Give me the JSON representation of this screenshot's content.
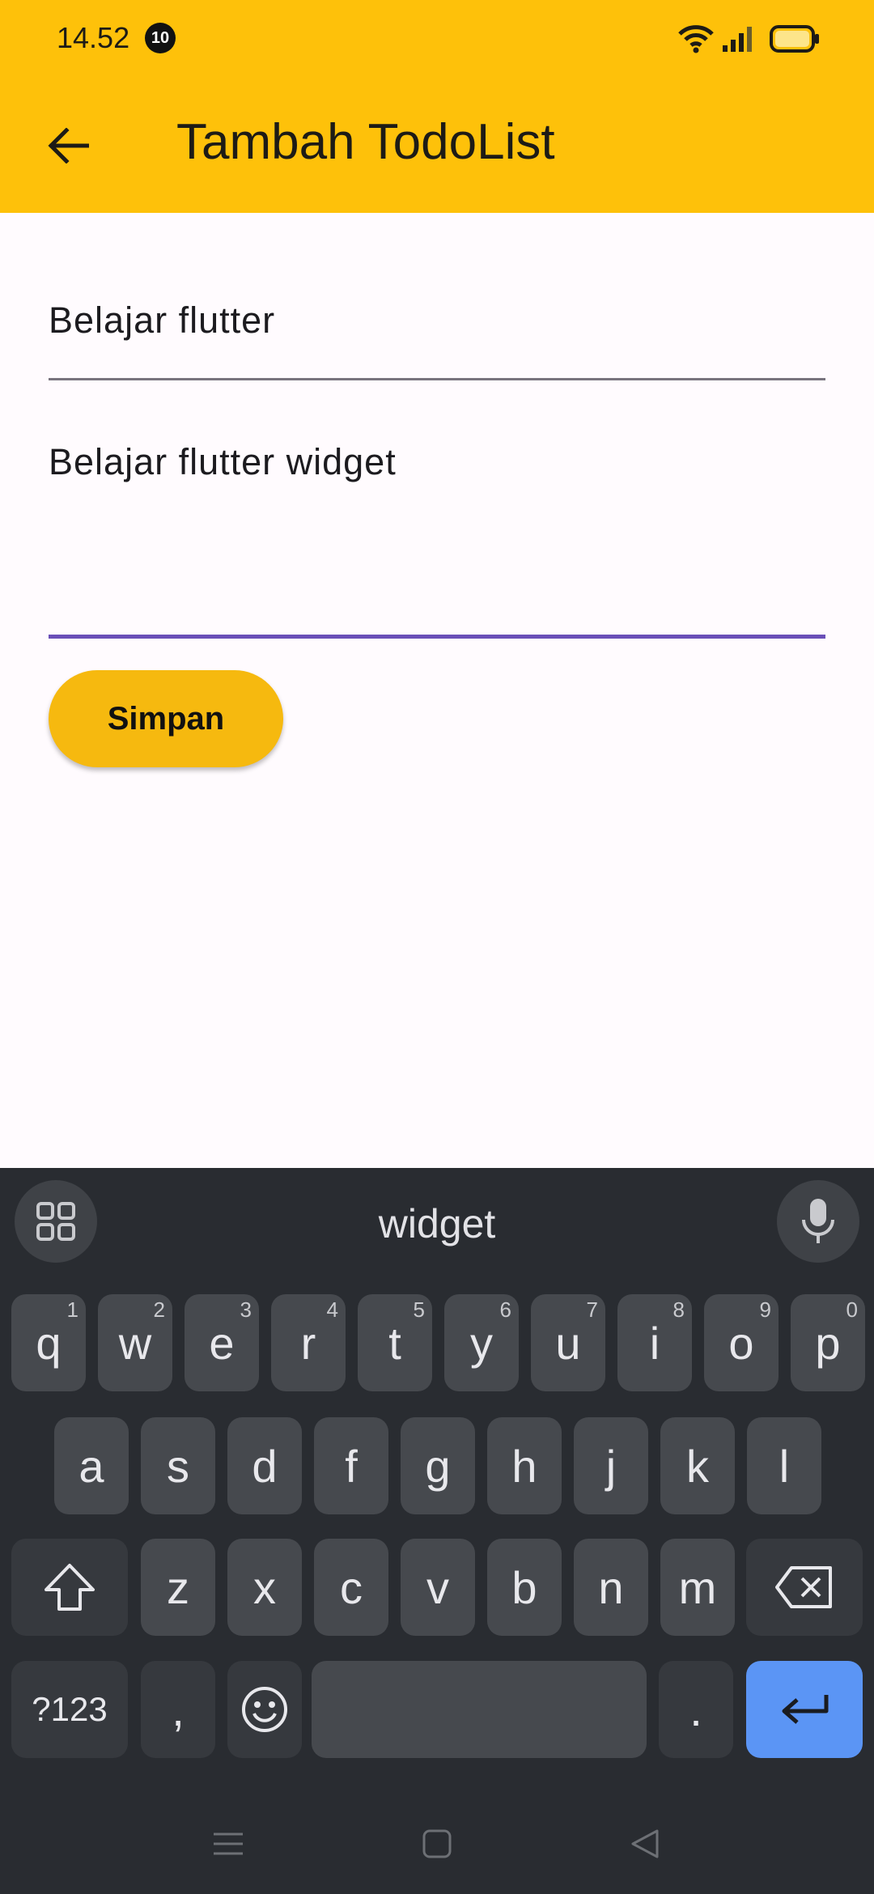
{
  "status_bar": {
    "time": "14.52",
    "notification_count": "10"
  },
  "app_bar": {
    "title": "Tambah TodoList"
  },
  "form": {
    "title_field_value": "Belajar flutter",
    "description_field_value": "Belajar flutter widget",
    "save_label": "Simpan"
  },
  "keyboard": {
    "suggestion": "widget",
    "row1": [
      {
        "k": "q",
        "h": "1"
      },
      {
        "k": "w",
        "h": "2"
      },
      {
        "k": "e",
        "h": "3"
      },
      {
        "k": "r",
        "h": "4"
      },
      {
        "k": "t",
        "h": "5"
      },
      {
        "k": "y",
        "h": "6"
      },
      {
        "k": "u",
        "h": "7"
      },
      {
        "k": "i",
        "h": "8"
      },
      {
        "k": "o",
        "h": "9"
      },
      {
        "k": "p",
        "h": "0"
      }
    ],
    "row2": [
      "a",
      "s",
      "d",
      "f",
      "g",
      "h",
      "j",
      "k",
      "l"
    ],
    "row3": [
      "z",
      "x",
      "c",
      "v",
      "b",
      "n",
      "m"
    ],
    "symbols_label": "?123",
    "comma": ",",
    "period": "."
  }
}
